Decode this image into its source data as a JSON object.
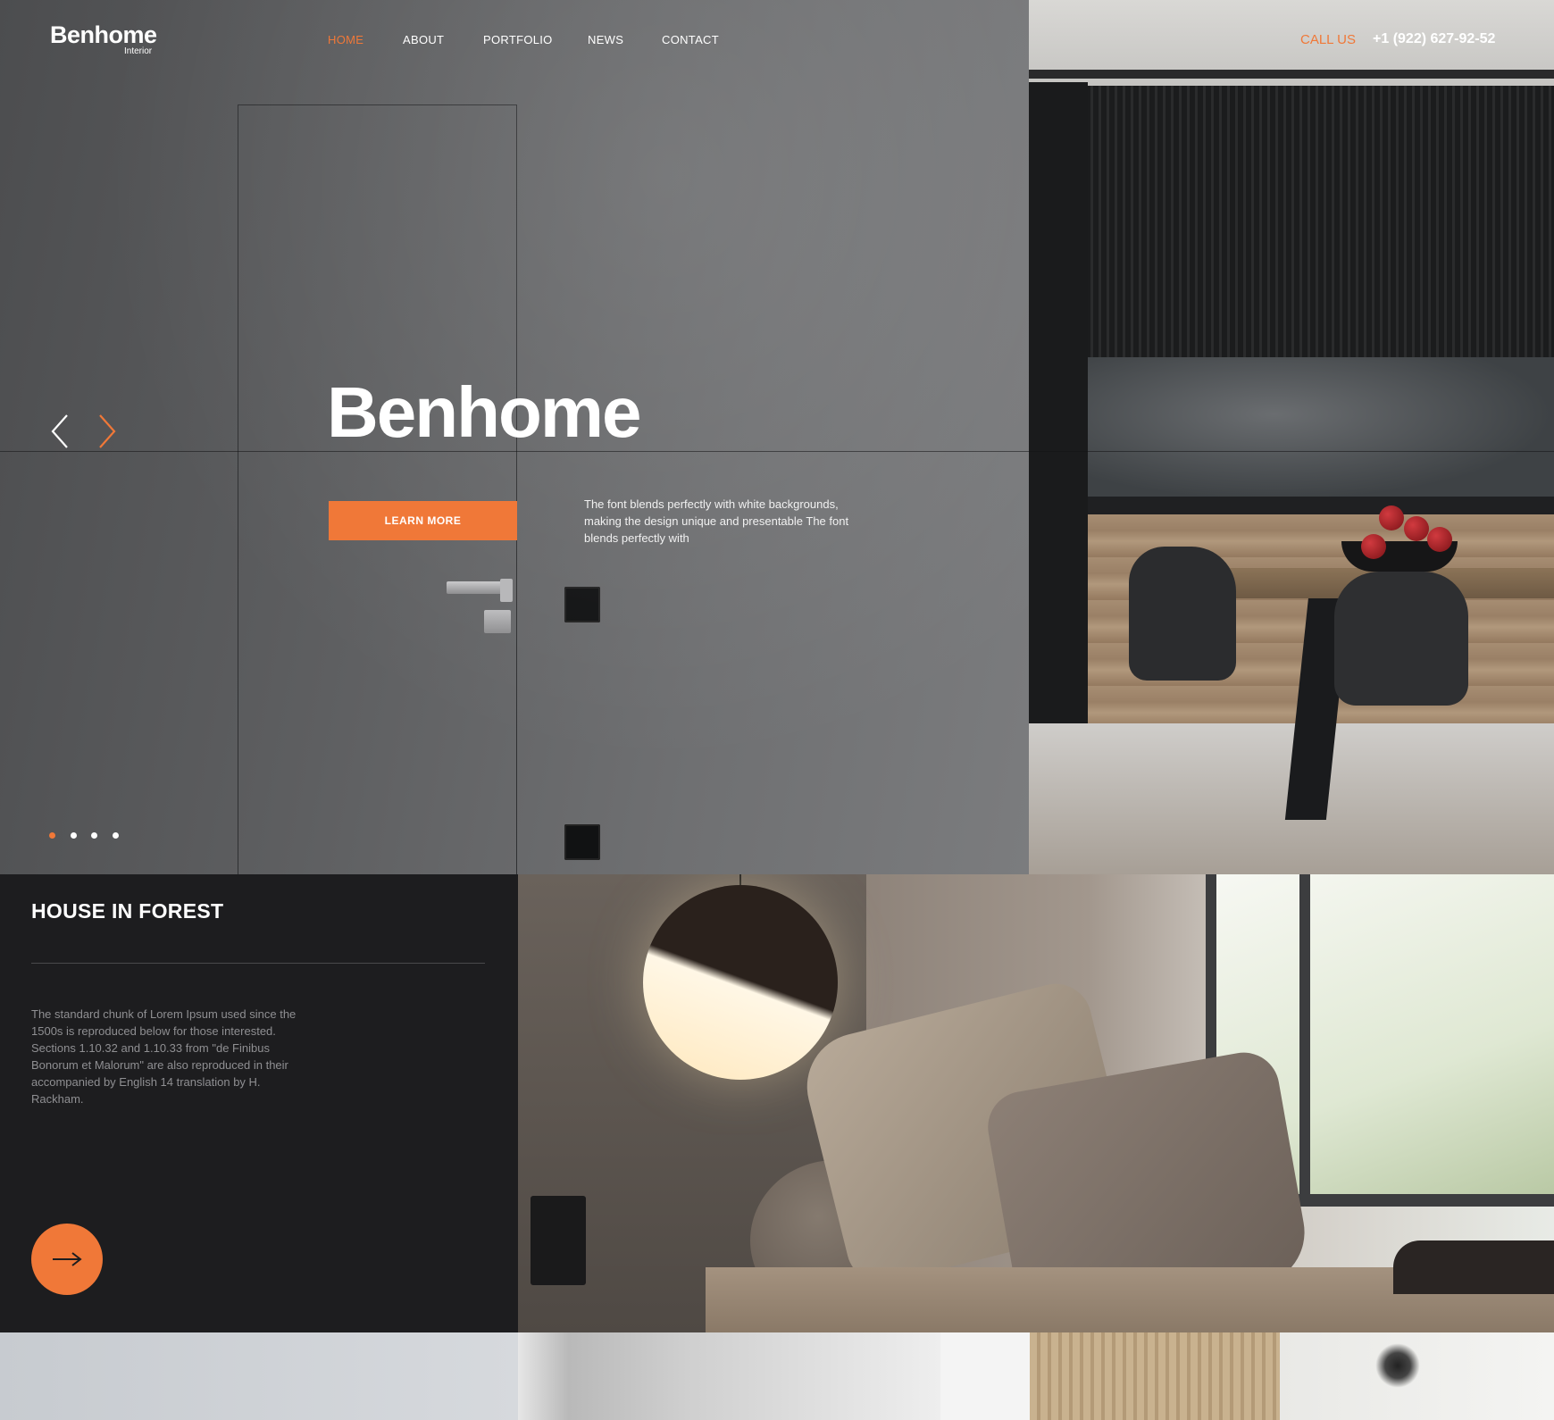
{
  "colors": {
    "accent": "#f07838",
    "dark_panel": "#1d1d1f",
    "text_light": "#ffffff",
    "text_muted": "#8f8f92"
  },
  "header": {
    "logo": "Benhome",
    "logo_sub": "Interior",
    "nav": [
      {
        "label": "HOME",
        "active": true
      },
      {
        "label": "ABOUT",
        "active": false
      },
      {
        "label": "PORTFOLIO",
        "active": false
      },
      {
        "label": "NEWS",
        "active": false
      },
      {
        "label": "CONTACT",
        "active": false
      }
    ],
    "call_label": "CALL US",
    "call_number": "+1 (922) 627-92-52"
  },
  "hero": {
    "title": "Benhome",
    "cta_label": "LEARN MORE",
    "description": "The font blends perfectly with white backgrounds, making the design unique and presentable The font blends perfectly with",
    "prev_icon": "chevron-left-icon",
    "next_icon": "chevron-right-icon",
    "slides_total": 4,
    "active_slide": 1
  },
  "project": {
    "title": "HOUSE IN FOREST",
    "description": "The standard chunk of Lorem Ipsum used since the 1500s is reproduced below for those interested. Sections 1.10.32 and 1.10.33 from \"de Finibus Bonorum et Malorum\"  are also reproduced in their  accompanied by English 14 translation by H. Rackham.",
    "button_icon": "arrow-right-icon"
  }
}
